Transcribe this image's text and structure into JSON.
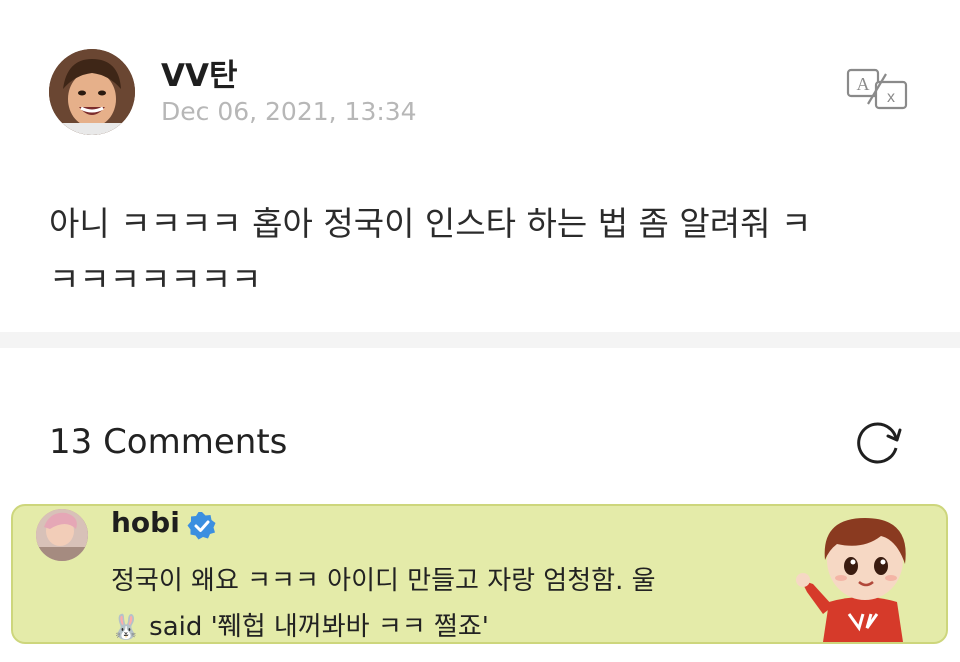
{
  "post": {
    "author": "VV탄",
    "timestamp": "Dec 06, 2021, 13:34",
    "body_line1": "아니 ㅋㅋㅋㅋ 홉아 정국이 인스타 하는 법 좀 알려줘 ㅋ",
    "body_line2": "ㅋㅋㅋㅋㅋㅋㅋ"
  },
  "icons": {
    "translate": "translate-icon",
    "refresh": "refresh-icon",
    "verified": "verified-badge-icon",
    "rabbit": "rabbit-icon",
    "sticker": "character-sticker"
  },
  "comments": {
    "count_label": "13 Comments",
    "items": [
      {
        "author": "hobi",
        "text_line1": "정국이 왜요 ㅋㅋㅋ 아이디 만들고 자랑 엄청함. 울",
        "text_emoji": "🐰",
        "text_line2": " said '쮀헙 내꺼봐바 ㅋㅋ 쩔죠'"
      }
    ]
  },
  "colors": {
    "highlight_bg": "#e4eba9",
    "highlight_border": "#cdd67c",
    "verified_blue": "#3b8fe0",
    "timestamp_gray": "#b7b7b7",
    "divider": "#f4f4f4"
  }
}
